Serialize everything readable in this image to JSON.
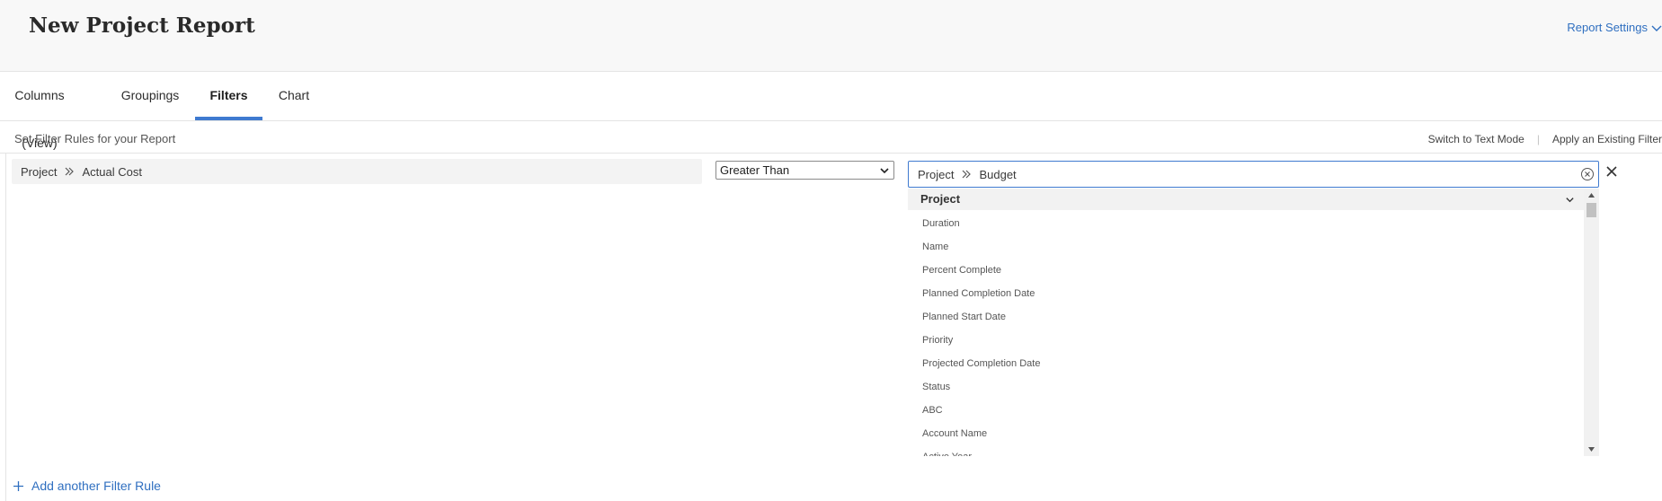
{
  "header": {
    "title": "New Project Report",
    "settings_label": "Report Settings"
  },
  "tabs": [
    {
      "label": "Columns (View)"
    },
    {
      "label": "Groupings"
    },
    {
      "label": "Filters"
    },
    {
      "label": "Chart"
    }
  ],
  "active_tab": "Filters",
  "rules_bar": {
    "title": "Set Filter Rules for your Report",
    "switch_label": "Switch to Text Mode",
    "apply_label": "Apply an Existing Filter"
  },
  "rule": {
    "field_object": "Project",
    "field_name": "Actual Cost",
    "operator": "Greater Than",
    "value_object": "Project",
    "value_field": "Budget"
  },
  "dropdown": {
    "group_label": "Project",
    "items": [
      "Duration",
      "Name",
      "Percent Complete",
      "Planned Completion Date",
      "Planned Start Date",
      "Priority",
      "Projected Completion Date",
      "Status",
      "ABC",
      "Account Name",
      "Active Year"
    ]
  },
  "add_rule_label": "Add another Filter Rule",
  "colors": {
    "accent": "#3f7ad0",
    "link": "#2f6fc0",
    "header_bg": "#f8f8f8"
  }
}
